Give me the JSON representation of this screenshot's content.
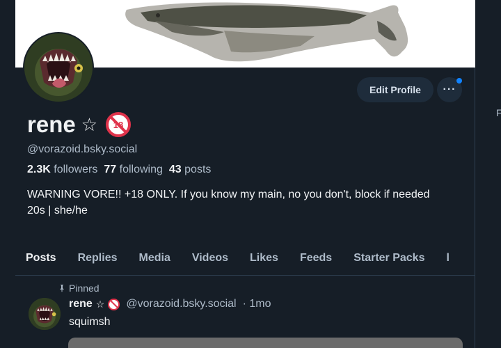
{
  "profile": {
    "display_name": "rene",
    "star": "☆",
    "age_badge": "18",
    "handle": "@vorazoid.bsky.social",
    "followers_count": "2.3K",
    "followers_label": "followers",
    "following_count": "77",
    "following_label": "following",
    "posts_count": "43",
    "posts_label": "posts",
    "bio_line1": "WARNING VORE!! +18 ONLY. If you know my main, no you don't, block if needed",
    "bio_line2": "20s | she/he"
  },
  "actions": {
    "edit_profile_label": "Edit Profile",
    "more_label": "···"
  },
  "tabs": [
    {
      "label": "Posts",
      "active": true
    },
    {
      "label": "Replies"
    },
    {
      "label": "Media"
    },
    {
      "label": "Videos"
    },
    {
      "label": "Likes"
    },
    {
      "label": "Feeds"
    },
    {
      "label": "Starter Packs"
    },
    {
      "label": "l"
    }
  ],
  "pinned_post": {
    "pinned_label": "Pinned",
    "author_name": "rene",
    "author_star": "☆",
    "author_handle": "@vorazoid.bsky.social",
    "time": "· 1mo",
    "text": "squimsh"
  },
  "right_panel": {
    "peek_text": "F"
  },
  "colors": {
    "background": "#161e27",
    "accent": "#1083fe",
    "muted_text": "#aebbc9",
    "badge_red": "#e0334b"
  },
  "icons": [
    "star-icon",
    "no-18-icon",
    "more-dots-icon",
    "notification-dot-icon",
    "pin-icon"
  ]
}
